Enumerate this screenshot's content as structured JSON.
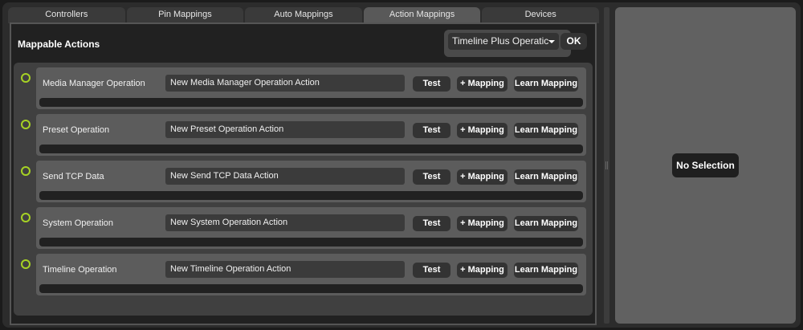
{
  "tabs": [
    {
      "label": "Controllers"
    },
    {
      "label": "Pin Mappings"
    },
    {
      "label": "Auto Mappings"
    },
    {
      "label": "Action Mappings"
    },
    {
      "label": "Devices"
    }
  ],
  "active_tab": "Action Mappings",
  "section_title": "Mappable Actions",
  "action_type_select": {
    "value": "Timeline Plus Operation",
    "display": "Timeline Plus Operatic"
  },
  "ok_label": "OK",
  "row_buttons": {
    "test": "Test",
    "add_mapping": "+ Mapping",
    "learn": "Learn Mapping"
  },
  "actions": [
    {
      "type": "Media Manager Operation",
      "name": "New Media Manager Operation Action"
    },
    {
      "type": "Preset Operation",
      "name": "New Preset Operation Action"
    },
    {
      "type": "Send TCP Data",
      "name": "New Send TCP Data Action"
    },
    {
      "type": "System Operation",
      "name": "New System Operation Action"
    },
    {
      "type": "Timeline Operation",
      "name": "New Timeline Operation Action"
    }
  ],
  "inspector": {
    "empty_label": "No Selection"
  },
  "colors": {
    "status_dot": "#a6d224"
  }
}
